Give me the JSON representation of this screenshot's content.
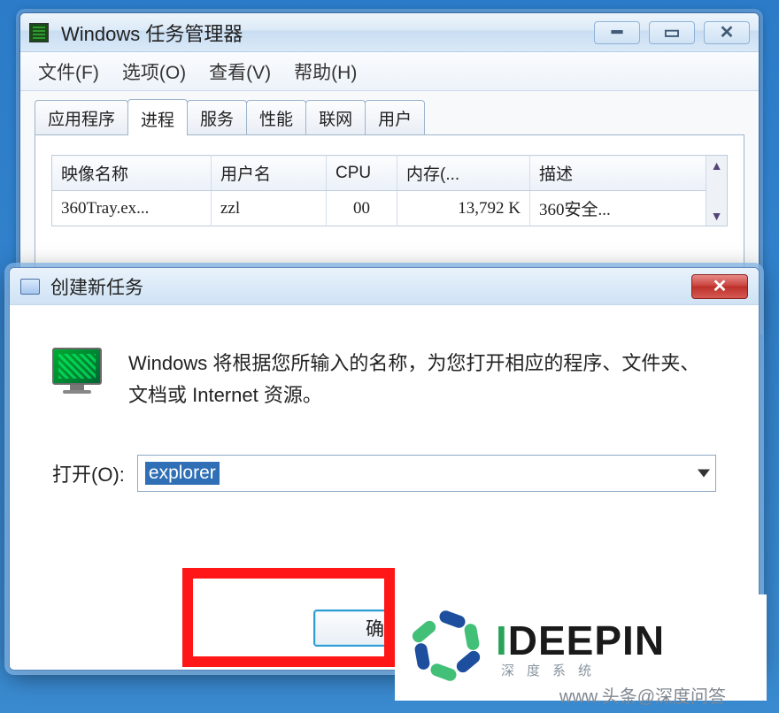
{
  "task_manager": {
    "title": "Windows 任务管理器",
    "menu": {
      "file": "文件(F)",
      "options": "选项(O)",
      "view": "查看(V)",
      "help": "帮助(H)"
    },
    "tabs": {
      "apps": "应用程序",
      "processes": "进程",
      "services": "服务",
      "performance": "性能",
      "network": "联网",
      "users": "用户"
    },
    "columns": {
      "image": "映像名称",
      "user": "用户名",
      "cpu": "CPU",
      "memory": "内存(...",
      "desc": "描述"
    },
    "rows": [
      {
        "image": "360Tray.ex...",
        "user": "zzl",
        "cpu": "00",
        "memory": "13,792 K",
        "desc": "360安全..."
      }
    ]
  },
  "run_dialog": {
    "title": "创建新任务",
    "message": "Windows 将根据您所输入的名称，为您打开相应的程序、文件夹、文档或 Internet 资源。",
    "open_label": "打开(O):",
    "open_value": "explorer",
    "ok": "确定"
  },
  "branding": {
    "logo": "IDEEPIN",
    "watermark": "www.头条@深度问答"
  }
}
